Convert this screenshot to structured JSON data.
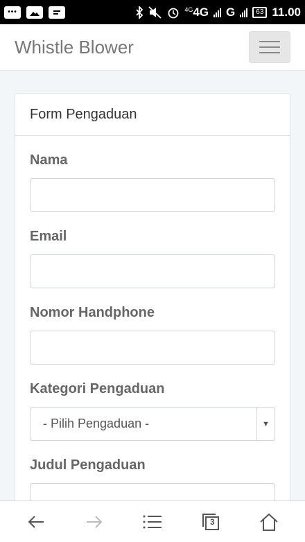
{
  "statusbar": {
    "network_small": "4G",
    "network": "4G",
    "network2": "G",
    "battery": "63",
    "time": "11.00"
  },
  "navbar": {
    "brand": "Whistle Blower"
  },
  "form": {
    "title": "Form Pengaduan",
    "fields": {
      "nama": {
        "label": "Nama",
        "value": ""
      },
      "email": {
        "label": "Email",
        "value": ""
      },
      "phone": {
        "label": "Nomor Handphone",
        "value": ""
      },
      "kategori": {
        "label": "Kategori Pengaduan",
        "selected": "- Pilih Pengaduan -"
      },
      "judul": {
        "label": "Judul Pengaduan",
        "value": ""
      }
    }
  },
  "bottombar": {
    "tab_count": "3"
  }
}
